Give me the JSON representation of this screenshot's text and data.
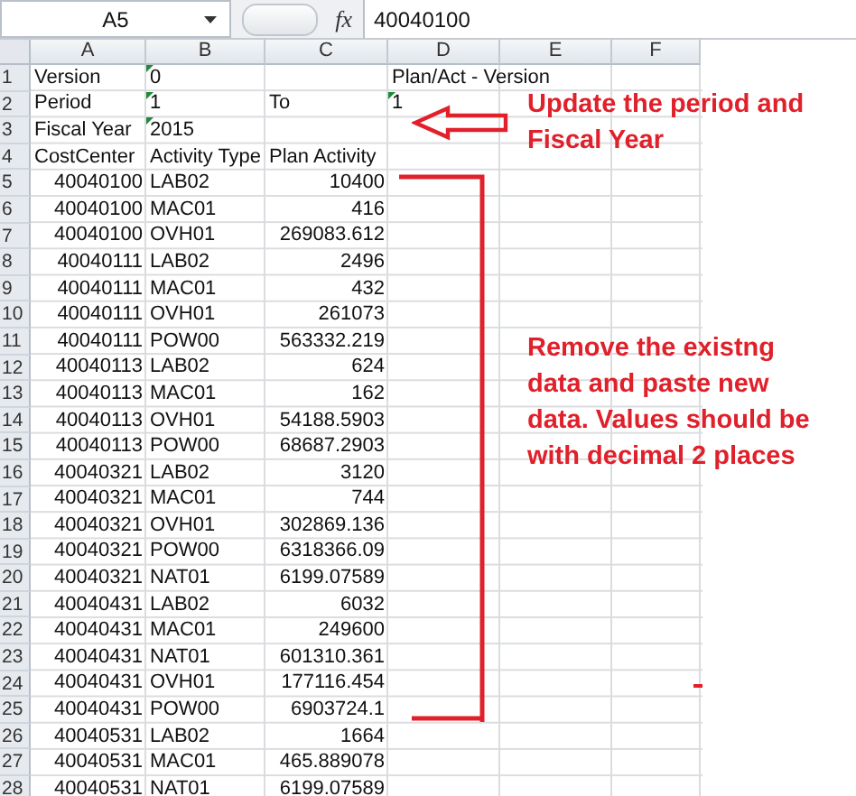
{
  "formula_bar": {
    "name_box": "A5",
    "fx_label": "fx",
    "formula": "40040100"
  },
  "columns": [
    "A",
    "B",
    "C",
    "D",
    "E",
    "F"
  ],
  "top_rows": [
    {
      "number": "1",
      "column_a": {
        "text": "Version",
        "flagged": false
      },
      "column_b": {
        "text": "0",
        "flagged": true
      },
      "column_d": {
        "text": "Plan/Act - Version",
        "flagged": false
      }
    },
    {
      "number": "2",
      "column_a": {
        "text": "Period",
        "flagged": false
      },
      "column_b": {
        "text": "1",
        "flagged": true
      },
      "column_c": {
        "text": "To",
        "flagged": false
      },
      "column_d": {
        "text": "1",
        "flagged": true
      }
    },
    {
      "number": "3",
      "column_a": {
        "text": "Fiscal Year",
        "flagged": false
      },
      "column_b": {
        "text": "2015",
        "flagged": true
      }
    },
    {
      "number": "4",
      "column_a": {
        "text": "CostCenter",
        "flagged": false
      },
      "column_b": {
        "text": "Activity Type",
        "flagged": false
      },
      "column_c": {
        "text": "Plan Activity",
        "flagged": false
      }
    }
  ],
  "data_rows": [
    {
      "number": "5",
      "cost_center": "40040100",
      "activity_type": "LAB02",
      "plan_activity": "10400"
    },
    {
      "number": "6",
      "cost_center": "40040100",
      "activity_type": "MAC01",
      "plan_activity": "416"
    },
    {
      "number": "7",
      "cost_center": "40040100",
      "activity_type": "OVH01",
      "plan_activity": "269083.612"
    },
    {
      "number": "8",
      "cost_center": "40040111",
      "activity_type": "LAB02",
      "plan_activity": "2496"
    },
    {
      "number": "9",
      "cost_center": "40040111",
      "activity_type": "MAC01",
      "plan_activity": "432"
    },
    {
      "number": "10",
      "cost_center": "40040111",
      "activity_type": "OVH01",
      "plan_activity": "261073"
    },
    {
      "number": "11",
      "cost_center": "40040111",
      "activity_type": "POW00",
      "plan_activity": "563332.219"
    },
    {
      "number": "12",
      "cost_center": "40040113",
      "activity_type": "LAB02",
      "plan_activity": "624"
    },
    {
      "number": "13",
      "cost_center": "40040113",
      "activity_type": "MAC01",
      "plan_activity": "162"
    },
    {
      "number": "14",
      "cost_center": "40040113",
      "activity_type": "OVH01",
      "plan_activity": "54188.5903"
    },
    {
      "number": "15",
      "cost_center": "40040113",
      "activity_type": "POW00",
      "plan_activity": "68687.2903"
    },
    {
      "number": "16",
      "cost_center": "40040321",
      "activity_type": "LAB02",
      "plan_activity": "3120"
    },
    {
      "number": "17",
      "cost_center": "40040321",
      "activity_type": "MAC01",
      "plan_activity": "744"
    },
    {
      "number": "18",
      "cost_center": "40040321",
      "activity_type": "OVH01",
      "plan_activity": "302869.136"
    },
    {
      "number": "19",
      "cost_center": "40040321",
      "activity_type": "POW00",
      "plan_activity": "6318366.09"
    },
    {
      "number": "20",
      "cost_center": "40040321",
      "activity_type": "NAT01",
      "plan_activity": "6199.07589"
    },
    {
      "number": "21",
      "cost_center": "40040431",
      "activity_type": "LAB02",
      "plan_activity": "6032"
    },
    {
      "number": "22",
      "cost_center": "40040431",
      "activity_type": "MAC01",
      "plan_activity": "249600"
    },
    {
      "number": "23",
      "cost_center": "40040431",
      "activity_type": "NAT01",
      "plan_activity": "601310.361"
    },
    {
      "number": "24",
      "cost_center": "40040431",
      "activity_type": "OVH01",
      "plan_activity": "177116.454"
    },
    {
      "number": "25",
      "cost_center": "40040431",
      "activity_type": "POW00",
      "plan_activity": "6903724.1"
    },
    {
      "number": "26",
      "cost_center": "40040531",
      "activity_type": "LAB02",
      "plan_activity": "1664"
    },
    {
      "number": "27",
      "cost_center": "40040531",
      "activity_type": "MAC01",
      "plan_activity": "465.889078"
    },
    {
      "number": "28",
      "cost_center": "40040531",
      "activity_type": "NAT01",
      "plan_activity": "6199.07589"
    }
  ],
  "annotations": [
    {
      "kind": "arrow_note",
      "text": "Update the period and Fiscal Year"
    },
    {
      "kind": "bracket_note",
      "text": "Remove the existng data and paste new data. Values should be with decimal 2 places"
    }
  ]
}
